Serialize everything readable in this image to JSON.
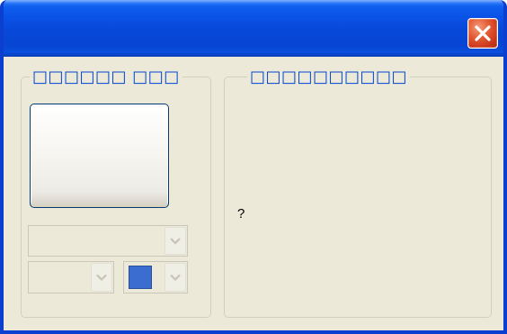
{
  "window": {
    "title": "",
    "close_icon": "close-x-icon"
  },
  "left_group": {
    "legend": "□□□□□□ □□□"
  },
  "right_group": {
    "legend": "□□□□□□□□□□",
    "preview_text": "?"
  },
  "font_combo": {
    "value": "",
    "arrow_icon": "chevron-down-icon"
  },
  "size_combo": {
    "value": "",
    "arrow_icon": "chevron-down-icon"
  },
  "color_combo": {
    "swatch_color": "#3b6ccf",
    "arrow_icon": "chevron-down-icon"
  },
  "colors": {
    "titlebar": "#0848d8",
    "window_face": "#ece9d8",
    "legend_text": "#0046d5",
    "close_button": "#e45a34"
  }
}
